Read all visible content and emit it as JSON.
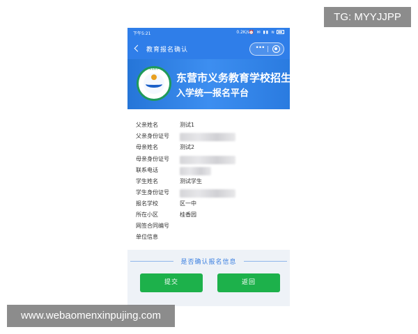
{
  "watermarks": {
    "top": "TG: MYYJJPP",
    "bottom": "www.webaomenxinpujing.com"
  },
  "status_bar": {
    "time": "下午5:21",
    "speed": "0.2K/s",
    "icons": "⏰ ✉ ▮▮ ≋"
  },
  "nav": {
    "title": "教育报名确认",
    "back_icon": "chevron-left-icon",
    "more_icon": "more-dots-icon",
    "close_icon": "circle-close-icon",
    "more_text": "•••"
  },
  "banner": {
    "title_line1": "东营市义务教育学校招生",
    "title_line2": "入学统一报名平台",
    "logo_text": "东营教育",
    "colors": {
      "bg": "#2f7ee9",
      "logo_ring": "#1f9a5a"
    }
  },
  "form": {
    "rows": [
      {
        "label": "父亲姓名",
        "value": "测试1",
        "masked": false
      },
      {
        "label": "父亲身份证号",
        "value": "",
        "masked": true
      },
      {
        "label": "母亲姓名",
        "value": "测试2",
        "masked": false
      },
      {
        "label": "母亲身份证号",
        "value": "",
        "masked": true
      },
      {
        "label": "联系电话",
        "value": "",
        "masked": true
      },
      {
        "label": "学生姓名",
        "value": "测试学生",
        "masked": false
      },
      {
        "label": "学生身份证号",
        "value": "",
        "masked": true
      },
      {
        "label": "报名学校",
        "value": "区一中",
        "masked": false
      },
      {
        "label": "所在小区",
        "value": "桂香园",
        "masked": false
      },
      {
        "label": "网签合同编号",
        "value": "",
        "masked": false
      },
      {
        "label": "单位信息",
        "value": "",
        "masked": false
      }
    ]
  },
  "confirm": {
    "question": "是否确认报名信息",
    "submit_label": "提交",
    "back_label": "返回",
    "colors": {
      "button": "#1db14b",
      "accent": "#3a7fe0"
    }
  }
}
